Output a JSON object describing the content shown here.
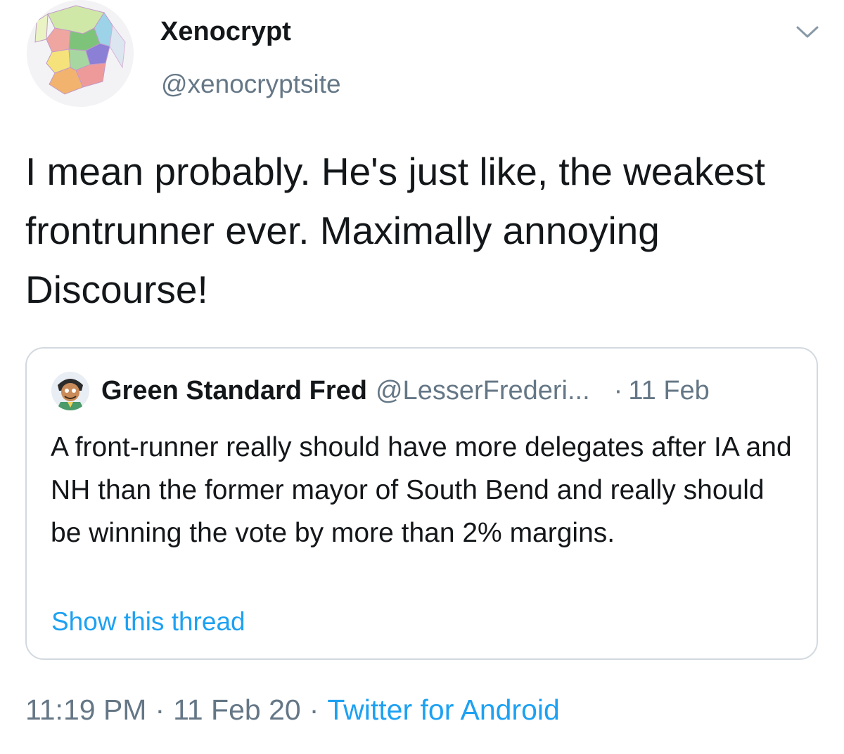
{
  "tweet": {
    "author": {
      "display_name": "Xenocrypt",
      "handle": "@xenocryptsite",
      "avatar_icon": "map-avatar-icon"
    },
    "menu_icon": "chevron-down-icon",
    "text": "I mean probably. He's just like, the weakest frontrunner ever. Maximally annoying Discourse!",
    "quoted": {
      "display_name": "Green Standard Fred",
      "handle": "@LesserFrederi...",
      "separator": "·",
      "date": "11 Feb",
      "text": "A front-runner really should have more delegates after IA and NH than the former mayor of South Bend and really should be winning the vote by more than 2% margins.",
      "show_thread_label": "Show this thread"
    },
    "meta": {
      "time": "11:19 PM",
      "separator": "·",
      "date": "11 Feb 20",
      "source": "Twitter for Android"
    }
  },
  "colors": {
    "text_primary": "#14171a",
    "text_secondary": "#657786",
    "link": "#1da1f2",
    "border": "#d2d9df"
  }
}
